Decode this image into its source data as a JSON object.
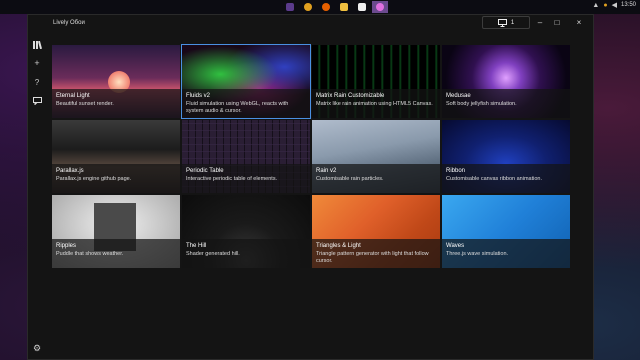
{
  "taskbar": {
    "apps": [
      {
        "icon": "explorer-icon",
        "color": "#5b3b8c"
      },
      {
        "icon": "chrome-icon",
        "color": "#e0a020"
      },
      {
        "icon": "firefox-icon",
        "color": "#e66000"
      },
      {
        "icon": "folder-icon",
        "color": "#f0c040"
      },
      {
        "icon": "calendar-icon",
        "color": "#3a7bd5"
      },
      {
        "icon": "lively-icon",
        "color": "#c040c0"
      }
    ],
    "time": "13:50"
  },
  "window": {
    "title": "Lively Обои",
    "screen_count": "1"
  },
  "wallpapers": [
    {
      "title": "Eternal Light",
      "desc": "Beautiful sunset render."
    },
    {
      "title": "Fluids v2",
      "desc": "Fluid simulation using WebGL, reacts with system audio & cursor."
    },
    {
      "title": "Matrix Rain Customizable",
      "desc": "Matrix like rain animation using HTML5 Canvas."
    },
    {
      "title": "Medusae",
      "desc": "Soft body jellyfish simulation."
    },
    {
      "title": "Parallax.js",
      "desc": "Parallax.js engine github page."
    },
    {
      "title": "Periodic Table",
      "desc": "Interactive periodic table of elements."
    },
    {
      "title": "Rain v2",
      "desc": "Customisable rain particles."
    },
    {
      "title": "Ribbon",
      "desc": "Customisable canvas ribbon animation."
    },
    {
      "title": "Ripples",
      "desc": "Puddle that shows weather."
    },
    {
      "title": "The Hill",
      "desc": "Shader generated hill."
    },
    {
      "title": "Triangles & Light",
      "desc": "Triangle pattern generator with light that follow cursor."
    },
    {
      "title": "Waves",
      "desc": "Three.js wave simulation."
    }
  ]
}
